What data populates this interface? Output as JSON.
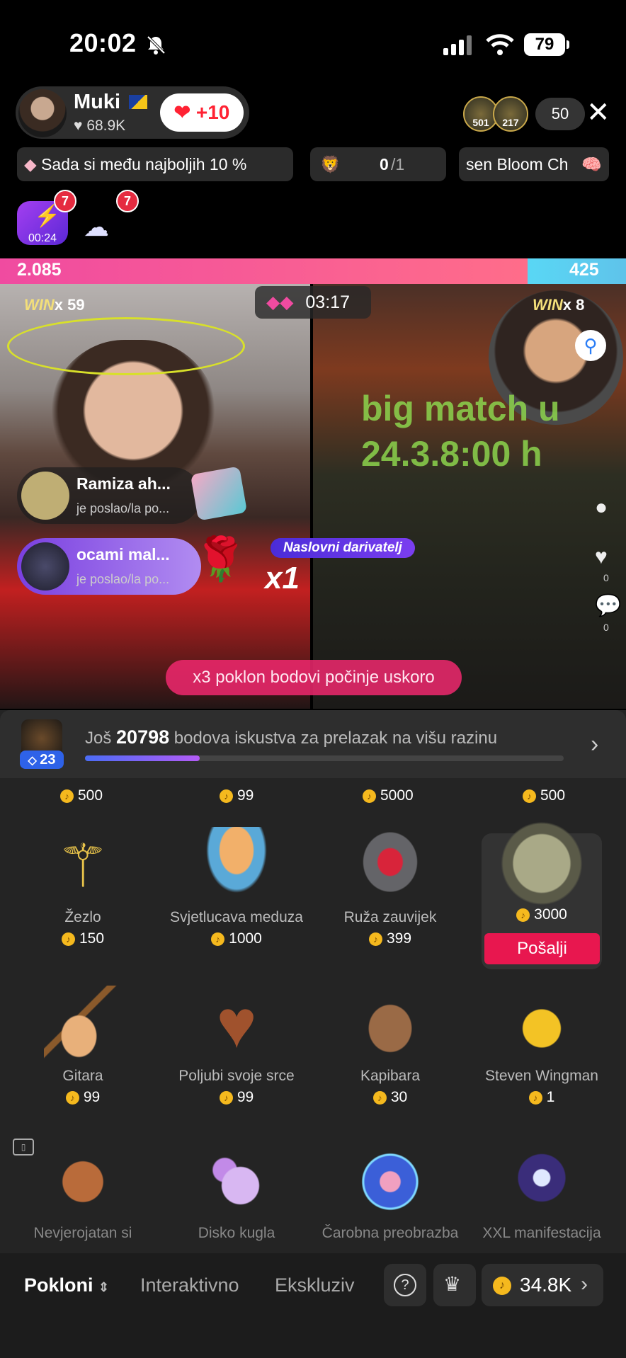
{
  "status": {
    "time": "20:02",
    "battery": "79"
  },
  "host": {
    "name": "Muki",
    "likes": "68.9K",
    "like_button": "+10"
  },
  "viewers": {
    "ranks": [
      "501",
      "217"
    ],
    "count": "50"
  },
  "pills": {
    "top": "Sada si među najboljih 10 %",
    "goal_current": "0",
    "goal_total": "/1",
    "ticker": "sen Bloom Ch"
  },
  "badges": {
    "first": "7",
    "second": "7",
    "timer": "00:24"
  },
  "battle": {
    "left_score": "2.085",
    "right_score": "425",
    "timer": "03:17",
    "left_win_label": "WIN",
    "left_win": "x 59",
    "right_win_label": "WIN",
    "right_win": "x 8",
    "overlay_lines": [
      "big match u",
      "24.3.8:00 h"
    ]
  },
  "gift_notices": [
    {
      "name": "Ramiza ah...",
      "sub": "je poslao/la po..."
    },
    {
      "name": "ocami mal...",
      "sub": "je poslao/la po..."
    }
  ],
  "naslovni": "Naslovni darivatelj",
  "combo": "x1",
  "banner": "x3 poklon bodovi počinje uskoro",
  "side": {
    "likes": "0",
    "comments": "0"
  },
  "level": {
    "badge": "23",
    "text_prefix": "Još",
    "points": "20798",
    "text_suffix": "bodova iskustva za prelazak na višu razinu",
    "progress": 0.24
  },
  "gifts": {
    "row0_prices": [
      "500",
      "99",
      "5000",
      "500"
    ],
    "row1": [
      {
        "name": "Žezlo",
        "price": "150",
        "icon": "scepter-icon"
      },
      {
        "name": "Svjetlucava meduza",
        "price": "1000",
        "icon": "jellyfish-icon"
      },
      {
        "name": "Ruža zauvijek",
        "price": "399",
        "icon": "rose-dome-icon"
      },
      {
        "name": "",
        "price": "3000",
        "icon": "car-icon"
      }
    ],
    "row2": [
      {
        "name": "Gitara",
        "price": "99",
        "icon": "guitar-icon"
      },
      {
        "name": "Poljubi svoje srce",
        "price": "99",
        "icon": "heart-cookie-icon"
      },
      {
        "name": "Kapibara",
        "price": "30",
        "icon": "capybara-icon"
      },
      {
        "name": "Steven Wingman",
        "price": "1",
        "icon": "bee-icon"
      }
    ],
    "row3": [
      {
        "name": "Nevjerojatan si",
        "icon": "teddy-bear-icon"
      },
      {
        "name": "Disko kugla",
        "icon": "disco-ball-icon"
      },
      {
        "name": "Čarobna preobrazba",
        "icon": "magic-orb-icon"
      },
      {
        "name": "XXL manifestacija",
        "icon": "crystal-ball-icon"
      }
    ],
    "send_label": "Pošalji"
  },
  "tabs": {
    "gifts": "Pokloni",
    "interactive": "Interaktivno",
    "exclusive": "Ekskluziv",
    "balance": "34.8K"
  },
  "colors": {
    "accent_pink": "#e8174f",
    "bar_left": "#f04ba0",
    "bar_right": "#59d7f5",
    "coin": "#f5b91e",
    "level_badge": "#2e62e8"
  }
}
